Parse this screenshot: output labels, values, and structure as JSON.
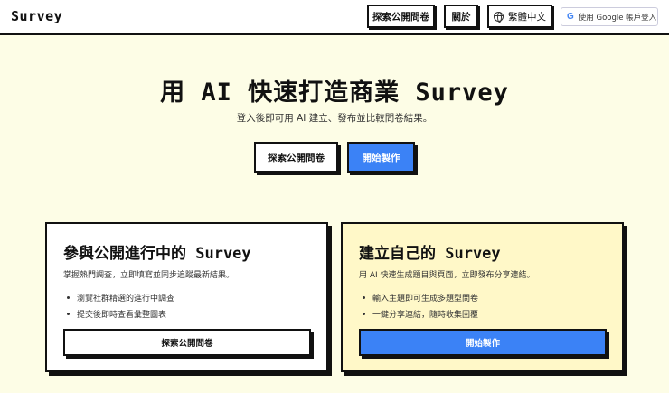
{
  "header": {
    "logo": "Survey",
    "explore_label": "探索公開問卷",
    "about_label": "關於",
    "language_label": "繁體中文",
    "google_login_label": "使用 Google 帳戶登入",
    "google_icon_text": "G"
  },
  "hero": {
    "title": "用 AI 快速打造商業 Survey",
    "subtitle": "登入後即可用 AI 建立、發布並比較問卷結果。",
    "explore_button": "探索公開問卷",
    "start_button": "開始製作"
  },
  "cards": {
    "participate": {
      "title": "參與公開進行中的 Survey",
      "description": "掌握熱門調查，立即填寫並同步追蹤最新結果。",
      "items": [
        "瀏覽社群精選的進行中調查",
        "提交後即時查看彙整圖表"
      ],
      "button": "探索公開問卷"
    },
    "create": {
      "title": "建立自己的 Survey",
      "description": "用 AI 快速生成題目與頁面，立即發布分享連結。",
      "items": [
        "輸入主題即可生成多題型問卷",
        "一鍵分享連結，隨時收集回覆"
      ],
      "button": "開始製作"
    }
  },
  "colors": {
    "background": "#fdfde6",
    "accent_blue": "#3b82f6",
    "card_highlight": "#fff8c8"
  },
  "icons": {
    "language": "globe-icon",
    "google": "google-icon"
  }
}
